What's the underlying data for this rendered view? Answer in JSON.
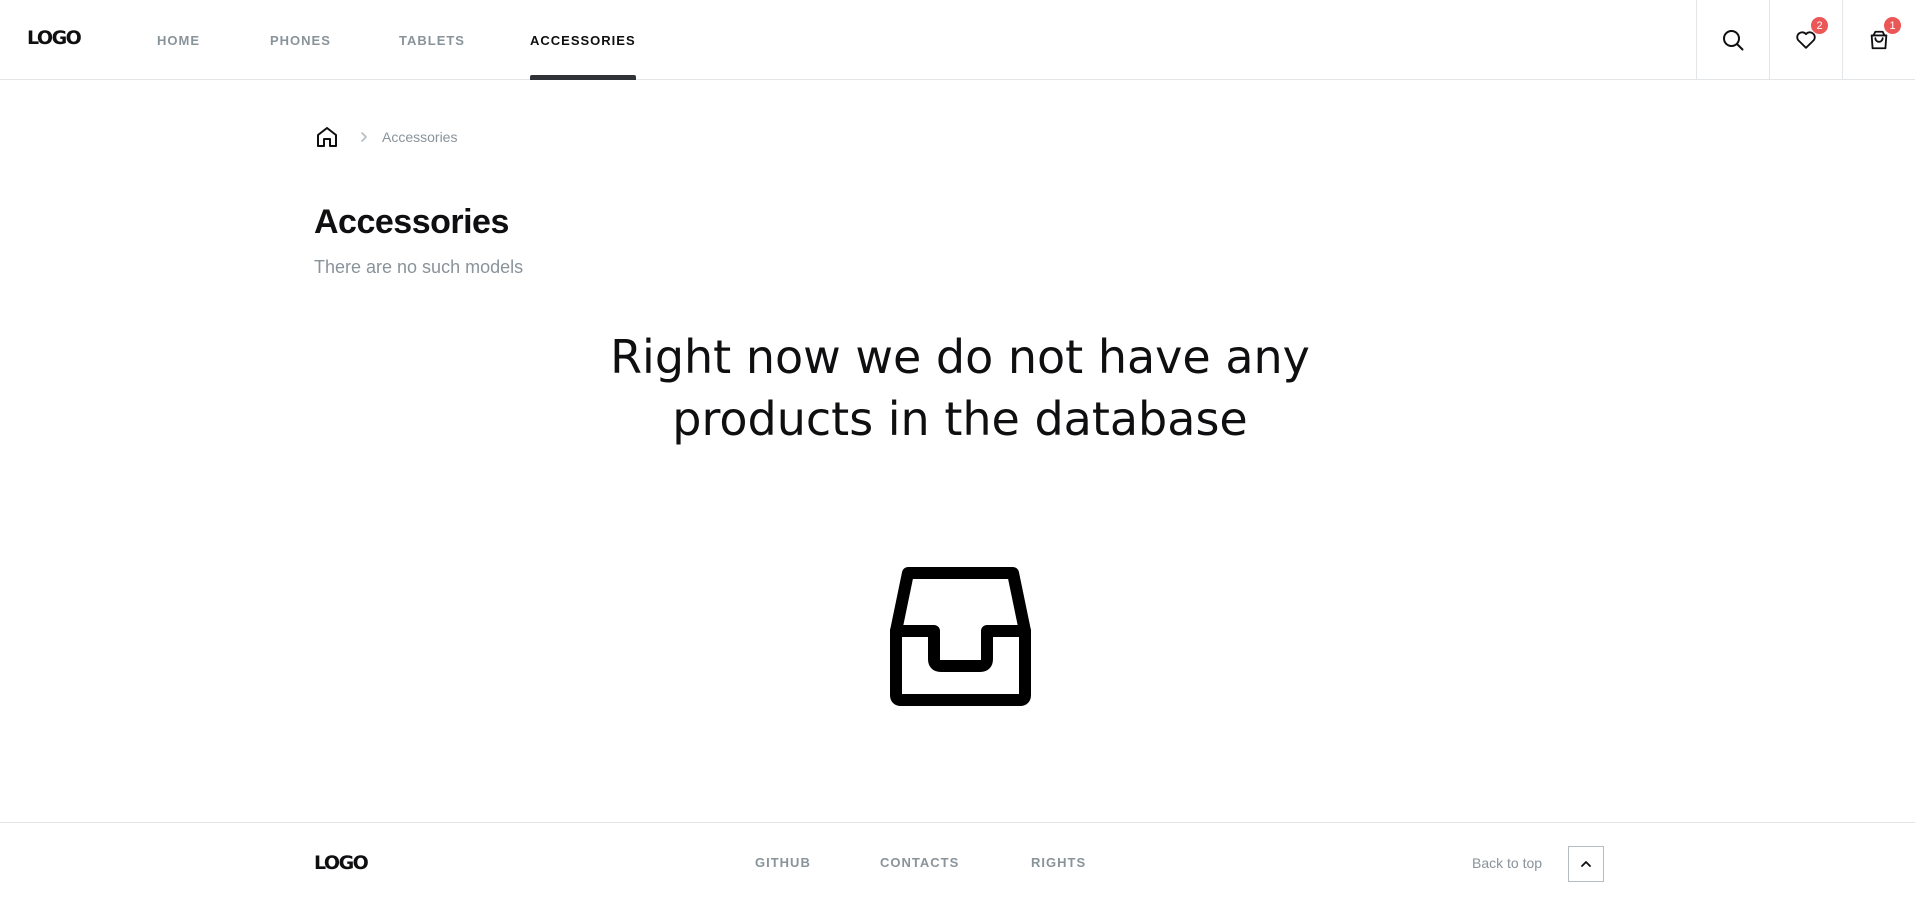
{
  "header": {
    "logo": "LOGO",
    "nav": [
      {
        "label": "HOME"
      },
      {
        "label": "PHONES"
      },
      {
        "label": "TABLETS"
      },
      {
        "label": "ACCESSORIES",
        "active": true
      }
    ],
    "actions": {
      "search_icon": "search-icon",
      "favorites_icon": "heart-icon",
      "favorites_count": "2",
      "cart_icon": "shopping-bag-icon",
      "cart_count": "1"
    }
  },
  "breadcrumb": {
    "home_icon": "home-icon",
    "separator_icon": "chevron-right-icon",
    "current": "Accessories"
  },
  "page": {
    "title": "Accessories",
    "subtitle": "There are no such models",
    "empty_message": "Right now we do not have any products in the database",
    "empty_icon": "inbox-icon"
  },
  "footer": {
    "logo": "LOGO",
    "links": [
      {
        "label": "GITHUB"
      },
      {
        "label": "CONTACTS"
      },
      {
        "label": "RIGHTS"
      }
    ],
    "back_to_top": "Back to top",
    "back_to_top_icon": "chevron-up-icon"
  },
  "colors": {
    "primary": "#0F0F11",
    "secondary": "#89939A",
    "accent_badge": "#EB5757",
    "border": "#E2E6E9"
  }
}
